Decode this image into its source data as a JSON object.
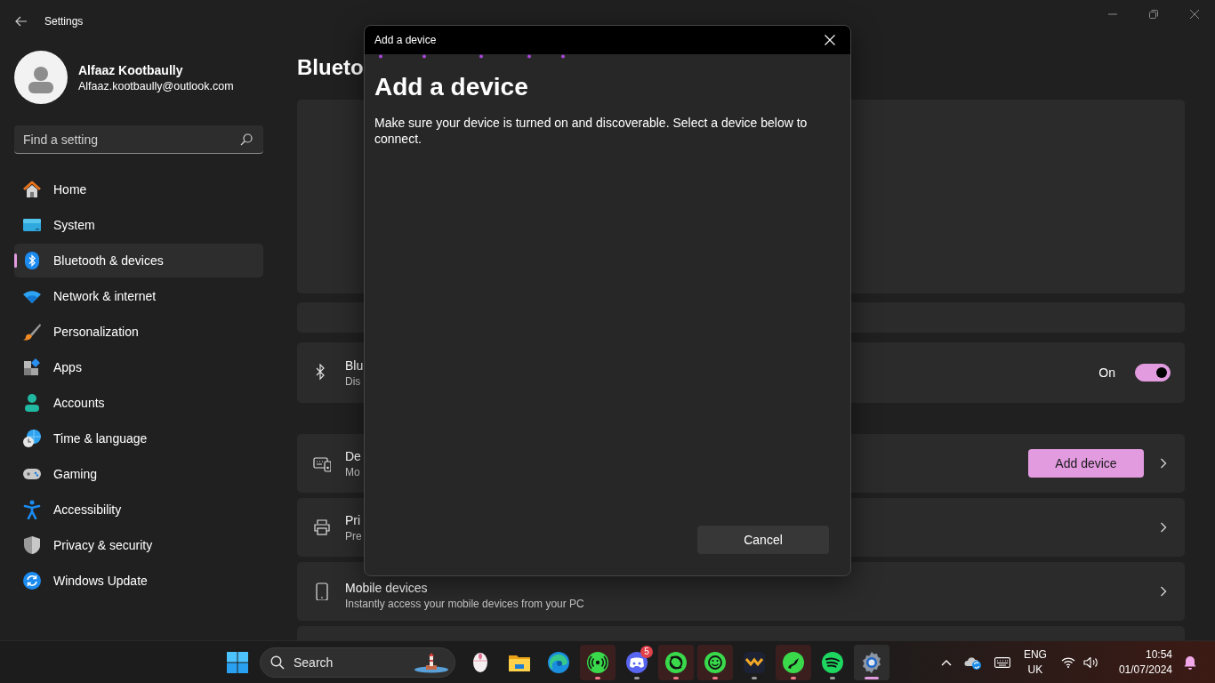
{
  "window": {
    "title": "Settings"
  },
  "user": {
    "name": "Alfaaz Kootbaully",
    "email": "Alfaaz.kootbaully@outlook.com"
  },
  "search": {
    "placeholder": "Find a setting"
  },
  "nav": [
    {
      "label": "Home",
      "selected": false
    },
    {
      "label": "System",
      "selected": false
    },
    {
      "label": "Bluetooth & devices",
      "selected": true
    },
    {
      "label": "Network & internet",
      "selected": false
    },
    {
      "label": "Personalization",
      "selected": false
    },
    {
      "label": "Apps",
      "selected": false
    },
    {
      "label": "Accounts",
      "selected": false
    },
    {
      "label": "Time & language",
      "selected": false
    },
    {
      "label": "Gaming",
      "selected": false
    },
    {
      "label": "Accessibility",
      "selected": false
    },
    {
      "label": "Privacy & security",
      "selected": false
    },
    {
      "label": "Windows Update",
      "selected": false
    }
  ],
  "page": {
    "title": "Blueto"
  },
  "rows": [
    {
      "kind": "toggle",
      "title": "Blu",
      "subtitle": "Dis",
      "state_label": "On",
      "on": true
    },
    {
      "kind": "button",
      "title": "De",
      "subtitle": "Mo",
      "button": "Add device"
    },
    {
      "kind": "link",
      "title": "Pri",
      "subtitle": "Pre"
    },
    {
      "kind": "link",
      "title": "Mobile devices",
      "subtitle": "Instantly access your mobile devices from your PC"
    }
  ],
  "dialog": {
    "title": "Add a device",
    "heading": "Add a device",
    "message": "Make sure your device is turned on and discoverable. Select a device below to connect.",
    "button": "Cancel"
  },
  "taskbar": {
    "search_placeholder": "Search",
    "apps": [
      {
        "running": false,
        "flashing": false,
        "selected": false
      },
      {
        "running": false,
        "flashing": false,
        "selected": false
      },
      {
        "running": false,
        "flashing": false,
        "selected": false
      },
      {
        "running": true,
        "flashing": true,
        "selected": false
      },
      {
        "running": true,
        "flashing": false,
        "selected": false,
        "badge": "5"
      },
      {
        "running": true,
        "flashing": true,
        "selected": false
      },
      {
        "running": true,
        "flashing": true,
        "selected": false
      },
      {
        "running": true,
        "flashing": false,
        "selected": false
      },
      {
        "running": true,
        "flashing": true,
        "selected": false
      },
      {
        "running": true,
        "flashing": false,
        "selected": false
      },
      {
        "running": true,
        "flashing": false,
        "selected": true
      }
    ],
    "tray": {
      "language": "ENG",
      "region": "UK",
      "time": "10:54",
      "date": "01/07/2024"
    }
  }
}
